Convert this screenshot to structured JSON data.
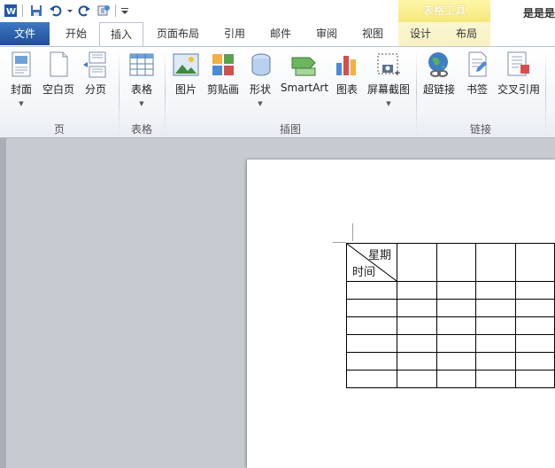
{
  "window": {
    "doc_title": "是是是",
    "context_header": "表格工具"
  },
  "tabs": [
    {
      "label": "文件"
    },
    {
      "label": "开始"
    },
    {
      "label": "插入"
    },
    {
      "label": "页面布局"
    },
    {
      "label": "引用"
    },
    {
      "label": "邮件"
    },
    {
      "label": "审阅"
    },
    {
      "label": "视图"
    },
    {
      "label": "设计"
    },
    {
      "label": "布局"
    }
  ],
  "ribbon": {
    "groups": {
      "page": "页",
      "table": "表格",
      "illustrations": "插图",
      "links": "链接"
    },
    "buttons": {
      "cover": "封面",
      "blank_page": "空白页",
      "page_break": "分页",
      "table": "表格",
      "picture": "图片",
      "clipart": "剪贴画",
      "shapes": "形状",
      "smartart": "SmartArt",
      "chart": "图表",
      "screenshot": "屏幕截图",
      "hyperlink": "超链接",
      "bookmark": "书签",
      "cross_ref": "交叉引用"
    }
  },
  "document": {
    "table": {
      "header_top": "星期",
      "header_bottom": "时间"
    }
  },
  "colors": {
    "file_tab": "#2b5797",
    "context_tab": "#f6e77d"
  }
}
